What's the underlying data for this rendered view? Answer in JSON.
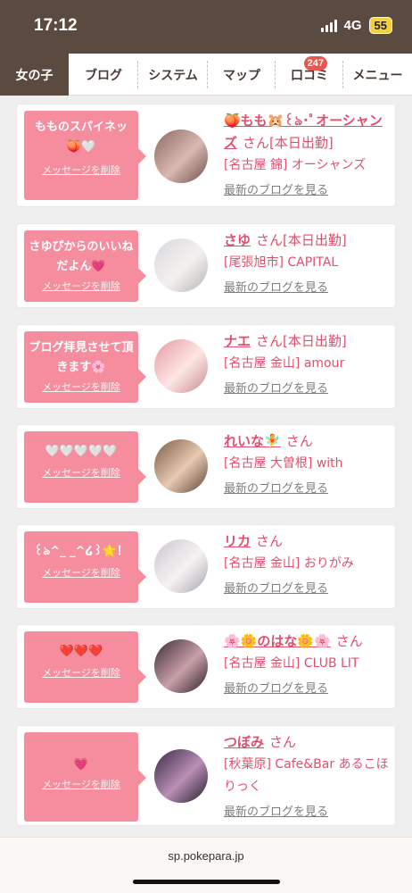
{
  "status": {
    "time": "17:12",
    "network": "4G",
    "battery": "55"
  },
  "tabs": [
    {
      "label": "女の子",
      "active": true
    },
    {
      "label": "ブログ"
    },
    {
      "label": "システム"
    },
    {
      "label": "マップ"
    },
    {
      "label": "口コミ",
      "badge": "247"
    },
    {
      "label": "メニュー"
    }
  ],
  "list_common": {
    "san": "さん",
    "delete_label": "メッセージを削除",
    "blog_link": "最新のブログを見る"
  },
  "cards": [
    {
      "message": "もものスパイネッ🍑🤍",
      "name": "🍑もも🐹꒰ঌ･ﾟオーシャンズ",
      "tag": "[本日出勤]",
      "shop": "[名古屋 錦] オーシャンズ"
    },
    {
      "message": "さゆぴからのいいねだよん💗",
      "name": "さゆ",
      "tag": "[本日出勤]",
      "shop": "[尾張旭市] CAPITAL"
    },
    {
      "message": "ブログ拝見させて頂きます🌸",
      "name": "ナエ",
      "tag": "[本日出勤]",
      "shop": "[名古屋 金山] amour"
    },
    {
      "message": "🤍🤍🤍🤍🤍",
      "name": "れいな🧚",
      "tag": "",
      "shop": "[名古屋 大曽根] with"
    },
    {
      "message": "꒰ঌ^_ _^໒꒱🌟！",
      "name": "リカ",
      "tag": "",
      "shop": "[名古屋 金山] おりがみ"
    },
    {
      "message": "❤️❤️❤️",
      "name": "🌸🌼のはな🌼🌸",
      "tag": "",
      "shop": "[名古屋 金山] CLUB LIT"
    },
    {
      "message": "💗",
      "name": "つぼみ",
      "tag": "",
      "shop": "[秋葉原] Cafe&Bar あるこほりっく"
    }
  ],
  "footer": {
    "url": "sp.pokepara.jp"
  }
}
